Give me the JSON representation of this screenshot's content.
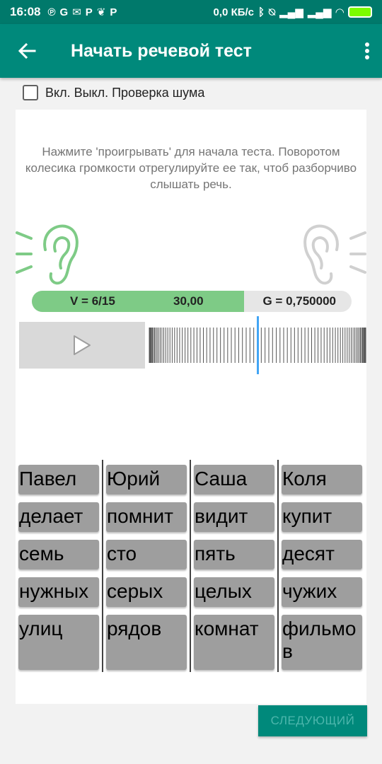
{
  "statusbar": {
    "time": "16:08",
    "left_icons": [
      "℗",
      "G",
      "✉",
      "P",
      "❦",
      "P"
    ],
    "net_speed": "0,0 КБ/с",
    "right_icons": [
      "bluetooth-icon",
      "alarm-off-icon",
      "signal-icon",
      "signal-icon",
      "wifi-icon",
      "battery-icon"
    ]
  },
  "appbar": {
    "title": "Начать речевой тест"
  },
  "noise_check": {
    "label": "Вкл. Выкл. Проверка шума",
    "checked": false
  },
  "instructions": "Нажмите 'проигрывать' для начала теста. Поворотом колесика громкости отрегулируйте ее так, чтоб разборчиво слышать речь.",
  "colors": {
    "primary": "#00897b",
    "primary_dark": "#00796b",
    "ear_active": "#7ecb86",
    "ear_inactive": "#d0d0d0",
    "dial_marker": "#42a5f5"
  },
  "level": {
    "v_label": "V = 6/15",
    "db_label": "30,00",
    "g_label": "G = 0,750000",
    "fill_fraction": 0.664
  },
  "words": {
    "columns": [
      [
        "Павел",
        "делает",
        "семь",
        "нужных",
        "улиц"
      ],
      [
        "Юрий",
        "помнит",
        "сто",
        "серых",
        "рядов"
      ],
      [
        "Саша",
        "видит",
        "пять",
        "целых",
        "комнат"
      ],
      [
        "Коля",
        "купит",
        "десят",
        "чужих",
        "фильмо\nв"
      ]
    ]
  },
  "next_button": "СЛЕДУЮЩИЙ"
}
